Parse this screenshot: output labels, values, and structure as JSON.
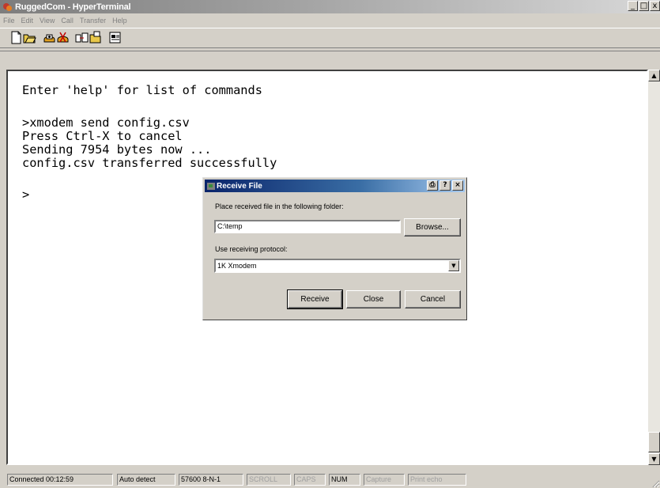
{
  "window": {
    "title": "RuggedCom - HyperTerminal",
    "controls": {
      "minimize": "_",
      "maximize": "□",
      "close": "x"
    }
  },
  "menu": [
    "File",
    "Edit",
    "View",
    "Call",
    "Transfer",
    "Help"
  ],
  "toolbar": {
    "icons": [
      "new-connection-icon",
      "open-icon",
      "call-icon",
      "disconnect-icon",
      "send-icon",
      "receive-icon",
      "properties-icon"
    ]
  },
  "terminal": {
    "lines": [
      "Enter 'help' for list of commands",
      ">xmodem send config.csv",
      "Press Ctrl-X to cancel",
      "Sending 7954 bytes now ...",
      "config.csv transferred successfully",
      ">"
    ]
  },
  "dialog": {
    "title": "Receive File",
    "title_buttons": [
      "⎙",
      "?",
      "×"
    ],
    "folder_label": "Place received file in the following folder:",
    "folder_value": "C:\\temp",
    "browse_label": "Browse...",
    "protocol_label": "Use receiving protocol:",
    "protocol_value": "1K Xmodem",
    "receive_label": "Receive",
    "close_label": "Close",
    "cancel_label": "Cancel"
  },
  "statusbar": {
    "connected": "Connected 00:12:59",
    "detect": "Auto detect",
    "port": "57600 8-N-1",
    "scroll": "SCROLL",
    "caps": "CAPS",
    "num": "NUM",
    "capture": "Capture",
    "print_echo": "Print echo"
  },
  "scrollbar": {
    "up": "▲",
    "down": "▼"
  }
}
